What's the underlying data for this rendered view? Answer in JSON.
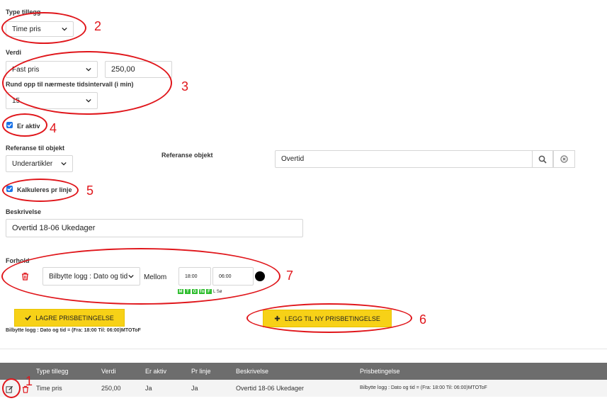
{
  "form": {
    "type_label": "Type tillegg",
    "type_value": "Time pris",
    "verdi_label": "Verdi",
    "verdi_select": "Fast pris",
    "verdi_value": "250,00",
    "roundup_label": "Rund opp til nærmeste tidsintervall (i min)",
    "roundup_value": "15",
    "aktiv_label": "Er aktiv",
    "ref_obj_label": "Referanse til objekt",
    "ref_obj_value": "Underartikler",
    "ref_objekt_label": "Referanse objekt",
    "ref_objekt_value": "Overtid",
    "kalk_label": "Kalkuleres pr linje",
    "beskrivelse_label": "Beskrivelse",
    "beskrivelse_value": "Overtid 18-06 Ukedager",
    "forhold_label": "Forhold",
    "cond_select": "Bilbytte logg : Dato og tid",
    "cond_op": "Mellom",
    "cond_from": "18:00",
    "cond_to": "06:00",
    "days": [
      "M",
      "T",
      "O",
      "To",
      "F"
    ],
    "days_suffix": "L Sø",
    "save_button": "LAGRE PRISBETINGELSE",
    "add_button": "LEGG TIL NY PRISBETINGELSE",
    "summary": "Bilbytte logg : Dato og tid = (Fra: 18:00 Til: 06:00)MTOToF"
  },
  "table": {
    "headers": [
      "Type tillegg",
      "Verdi",
      "Er aktiv",
      "Pr linje",
      "Beskrivelse",
      "Prisbetingelse"
    ],
    "row": [
      "Time pris",
      "250,00",
      "Ja",
      "Ja",
      "Overtid 18-06 Ukedager",
      "Bilbytte logg : Dato og tid = (Fra: 18:00 Til: 06:00)MTOToF"
    ]
  },
  "annotations": [
    "1",
    "2",
    "3",
    "4",
    "5",
    "6",
    "7"
  ],
  "colors": {
    "accent": "#f7d117",
    "annotation": "#e0161b",
    "header_bg": "#6d6d6d",
    "day_green": "#2ebd2e",
    "checkbox": "#1a73e8"
  }
}
